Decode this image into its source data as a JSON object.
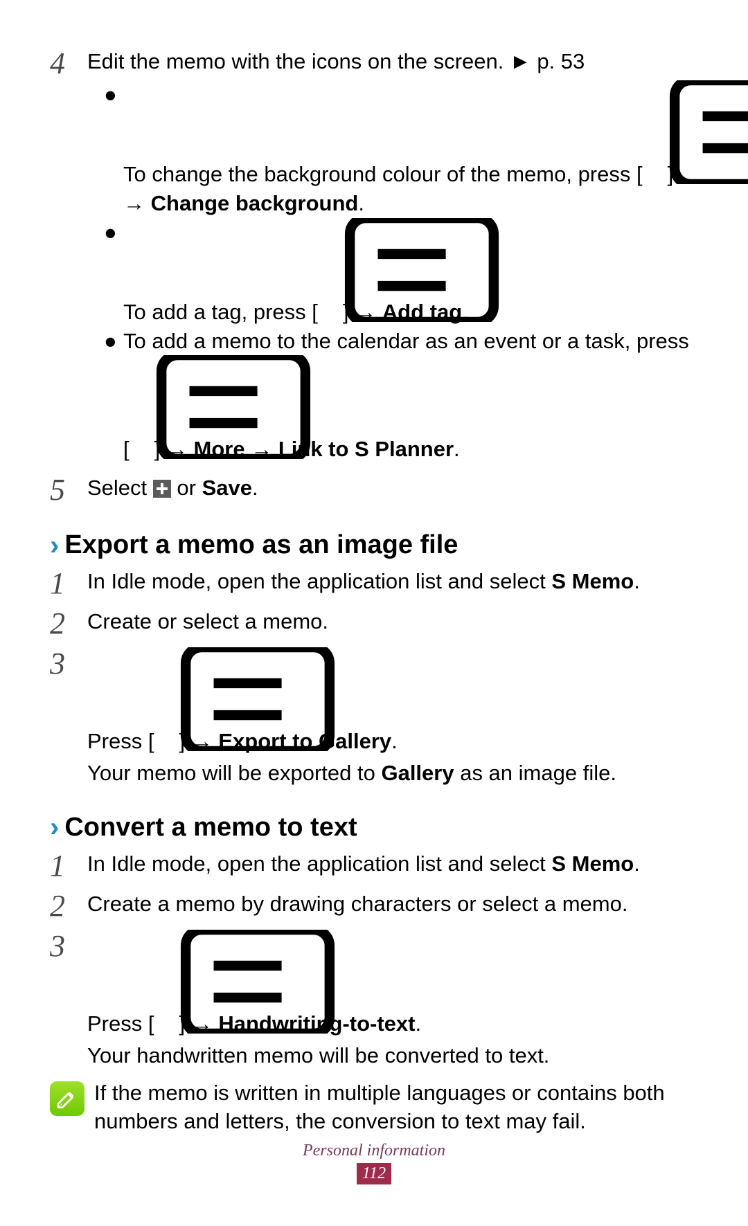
{
  "top": {
    "step4": {
      "num": "4",
      "line": "Edit the memo with the icons on the screen.",
      "pref_arrow": "►",
      "pref": "p. 53",
      "bullets": [
        {
          "pre": "To change the background colour of the memo, press [",
          "post_bracket": "]",
          "arrow": "→",
          "bold": "Change background",
          "after": "."
        },
        {
          "pre": "To add a tag, press [",
          "post_bracket": "]",
          "arrow": "→",
          "bold": "Add tag",
          "after": "."
        },
        {
          "pre": "To add a memo to the calendar as an event or a task, press [",
          "post_bracket": "]",
          "arrow": "→",
          "bold1": "More",
          "arrow2": "→",
          "bold2": "Link to S Planner",
          "after": "."
        }
      ]
    },
    "step5": {
      "num": "5",
      "pre": "Select ",
      "mid": " or ",
      "bold": "Save",
      "after": "."
    }
  },
  "export": {
    "header": "Export a memo as an image file",
    "steps": [
      {
        "num": "1",
        "pre": "In Idle mode, open the application list and select ",
        "bold": "S Memo",
        "after": "."
      },
      {
        "num": "2",
        "text": "Create or select a memo."
      },
      {
        "num": "3",
        "pre": "Press [",
        "post_bracket": "]",
        "arrow": "→",
        "bold": "Export to Gallery",
        "after": ".",
        "cont_pre": "Your memo will be exported to ",
        "cont_bold": "Gallery",
        "cont_after": " as an image file."
      }
    ]
  },
  "convert": {
    "header": "Convert a memo to text",
    "steps": [
      {
        "num": "1",
        "pre": "In Idle mode, open the application list and select ",
        "bold": "S Memo",
        "after": "."
      },
      {
        "num": "2",
        "text": "Create a memo by drawing characters or select a memo."
      },
      {
        "num": "3",
        "pre": "Press [",
        "post_bracket": "]",
        "arrow": "→",
        "bold": "Handwriting-to-text",
        "after": ".",
        "cont": "Your handwritten memo will be converted to text."
      }
    ],
    "note": "If the memo is written in multiple languages or contains both numbers and letters, the conversion to text may fail."
  },
  "footer": {
    "label": "Personal information",
    "page": "112"
  }
}
